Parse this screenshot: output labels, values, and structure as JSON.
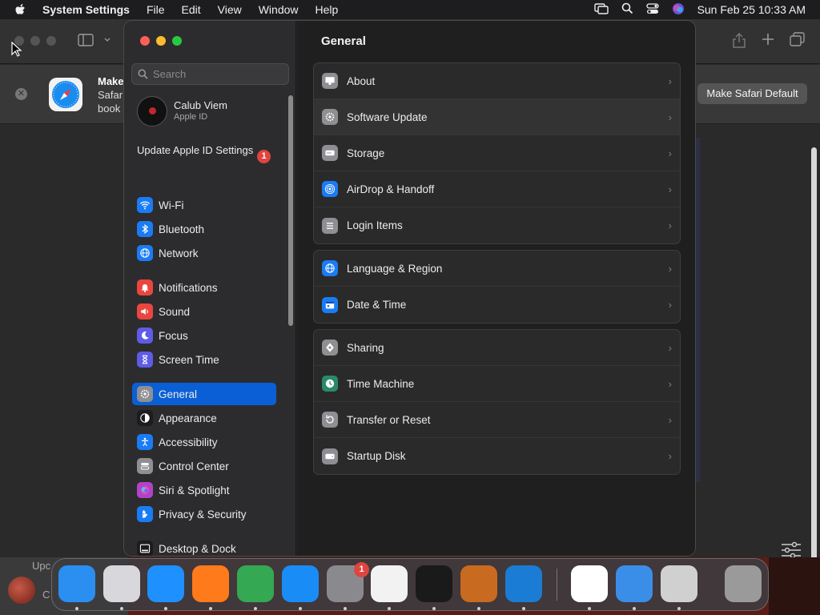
{
  "menubar": {
    "app_name": "System Settings",
    "items": [
      "File",
      "Edit",
      "View",
      "Window",
      "Help"
    ],
    "clock": "Sun Feb 25  10:33 AM"
  },
  "safari": {
    "banner_title": "Make",
    "banner_line2": "Safar",
    "banner_line3": "book",
    "make_default_label": "Make Safari Default",
    "peek_text_top": "Upc",
    "peek_text_bottom": "C"
  },
  "settings": {
    "search_placeholder": "Search",
    "account": {
      "name": "Calub Viem",
      "subtitle": "Apple ID"
    },
    "update_apple_id": "Update Apple ID Settings",
    "update_badge": "1",
    "sidebar_items": [
      {
        "label": "Wi-Fi",
        "icon": "wifi-icon",
        "color": "#1a7cf5"
      },
      {
        "label": "Bluetooth",
        "icon": "bluetooth-icon",
        "color": "#1a7cf5"
      },
      {
        "label": "Network",
        "icon": "globe-icon",
        "color": "#1a7cf5"
      },
      {
        "label": "Notifications",
        "icon": "bell-icon",
        "color": "#e9463f"
      },
      {
        "label": "Sound",
        "icon": "speaker-icon",
        "color": "#e9463f"
      },
      {
        "label": "Focus",
        "icon": "moon-icon",
        "color": "#5e5ce6"
      },
      {
        "label": "Screen Time",
        "icon": "hourglass-icon",
        "color": "#5e5ce6"
      },
      {
        "label": "General",
        "icon": "gear-icon",
        "color": "#8e8e93"
      },
      {
        "label": "Appearance",
        "icon": "appearance-icon",
        "color": "#1c1c1e"
      },
      {
        "label": "Accessibility",
        "icon": "accessibility-icon",
        "color": "#1a7cf5"
      },
      {
        "label": "Control Center",
        "icon": "control-center-icon",
        "color": "#8e8e93"
      },
      {
        "label": "Siri & Spotlight",
        "icon": "siri-icon",
        "color": "#b044c8"
      },
      {
        "label": "Privacy & Security",
        "icon": "hand-icon",
        "color": "#1a7cf5"
      },
      {
        "label": "Desktop & Dock",
        "icon": "dock-icon",
        "color": "#1c1c1e"
      }
    ],
    "main_title": "General",
    "groups": [
      [
        {
          "label": "About",
          "icon": "display-icon",
          "color": "#8e8e93"
        },
        {
          "label": "Software Update",
          "icon": "gear-icon",
          "color": "#8e8e93"
        },
        {
          "label": "Storage",
          "icon": "drive-icon",
          "color": "#8e8e93"
        },
        {
          "label": "AirDrop & Handoff",
          "icon": "airdrop-icon",
          "color": "#1a7cf5"
        },
        {
          "label": "Login Items",
          "icon": "list-icon",
          "color": "#8e8e93"
        }
      ],
      [
        {
          "label": "Language & Region",
          "icon": "globe-icon",
          "color": "#1a7cf5"
        },
        {
          "label": "Date & Time",
          "icon": "calendar-icon",
          "color": "#1a7cf5"
        }
      ],
      [
        {
          "label": "Sharing",
          "icon": "sharing-icon",
          "color": "#8e8e93"
        },
        {
          "label": "Time Machine",
          "icon": "time-machine-icon",
          "color": "#2a8a6a"
        },
        {
          "label": "Transfer or Reset",
          "icon": "reset-icon",
          "color": "#8e8e93"
        },
        {
          "label": "Startup Disk",
          "icon": "disk-icon",
          "color": "#8e8e93"
        }
      ]
    ]
  },
  "dock": {
    "apps": [
      {
        "name": "Finder",
        "icon": "finder-icon",
        "color": "#2a8ff0"
      },
      {
        "name": "Launchpad",
        "icon": "launchpad-icon",
        "color": "#d8d8dc"
      },
      {
        "name": "Safari",
        "icon": "safari-icon",
        "color": "#1e90ff"
      },
      {
        "name": "Firefox",
        "icon": "firefox-icon",
        "color": "#ff7a1a"
      },
      {
        "name": "Chrome",
        "icon": "chrome-icon",
        "color": "#34a853"
      },
      {
        "name": "App Store",
        "icon": "app-store-icon",
        "color": "#1a8cf5"
      },
      {
        "name": "System Settings",
        "icon": "system-settings-icon",
        "color": "#8a8a8e"
      },
      {
        "name": "TextEdit",
        "icon": "textedit-icon",
        "color": "#f2f2f2"
      },
      {
        "name": "Terminal",
        "icon": "terminal-icon",
        "color": "#1a1a1a"
      },
      {
        "name": "GarageBand",
        "icon": "garageband-icon",
        "color": "#c86a20"
      },
      {
        "name": "VS Code",
        "icon": "vscode-icon",
        "color": "#1a7cd4"
      },
      {
        "name": "Visual Studio",
        "icon": "visual-studio-icon",
        "color": "#ffffff"
      },
      {
        "name": "Weather",
        "icon": "weather-icon",
        "color": "#3a8ee8"
      },
      {
        "name": "Boot Camp Assistant",
        "icon": "bootcamp-icon",
        "color": "#d0d0d0"
      },
      {
        "name": "Trash",
        "icon": "trash-icon",
        "color": "#9a9a9a"
      }
    ],
    "settings_badge": "1"
  }
}
